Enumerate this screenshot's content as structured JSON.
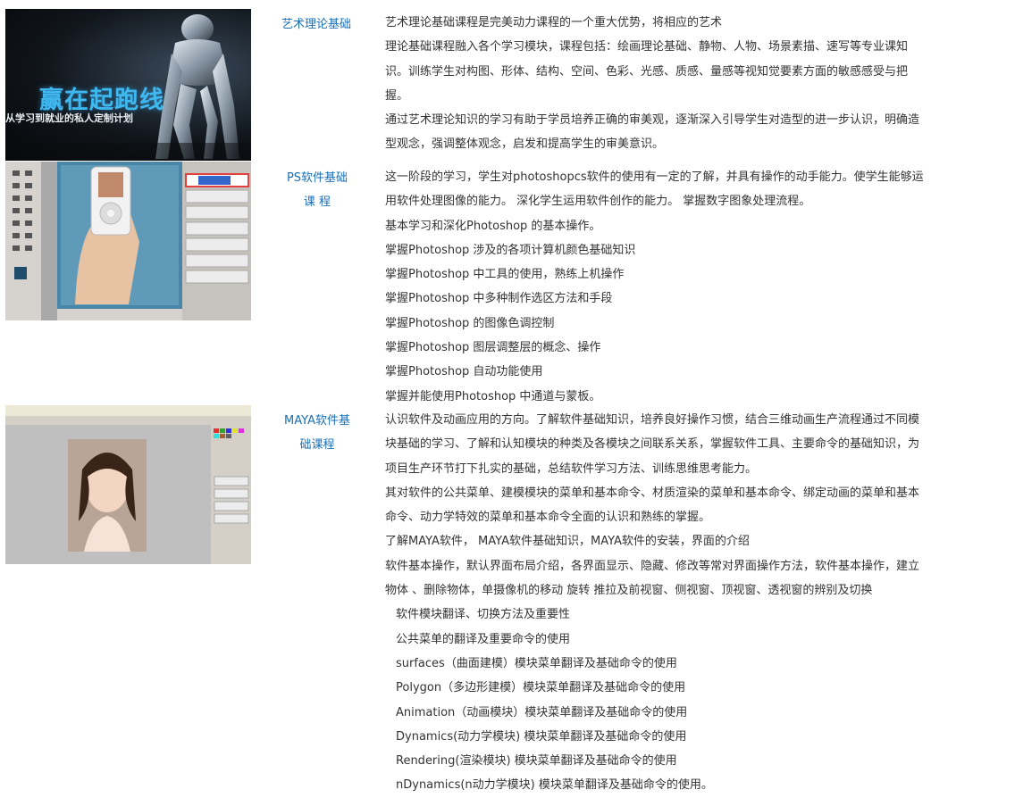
{
  "images": [
    {
      "name": "banner",
      "text_big": "赢在起跑线",
      "text_small": "从学习到就业的私人定制计划"
    },
    {
      "name": "photoshop-screenshot"
    },
    {
      "name": "maya-screenshot"
    }
  ],
  "sections": [
    {
      "label": "艺术理论基础",
      "lines": [
        "艺术理论基础课程是完美动力课程的一个重大优势，将相应的艺术",
        "理论基础课程融入各个学习模块，课程包括：绘画理论基础、静物、人物、场景素描、速写等专业课知识。训练学生对构图、形体、结构、空间、色彩、光感、质感、量感等视知觉要素方面的敏感感受与把握。",
        "通过艺术理论知识的学习有助于学员培养正确的审美观，逐渐深入引导学生对造型的进一步认识，明确造型观念，强调整体观念，启发和提高学生的审美意识。"
      ]
    },
    {
      "label1": "PS软件基础",
      "label2": "课 程",
      "lines": [
        "这一阶段的学习，学生对photoshopcs软件的使用有一定的了解，并具有操作的动手能力。使学生能够运用软件处理图像的能力。 深化学生运用软件创作的能力。 掌握数字图象处理流程。",
        "基本学习和深化Photoshop 的基本操作。",
        "掌握Photoshop 涉及的各项计算机颜色基础知识",
        "掌握Photoshop 中工具的使用，熟练上机操作",
        "掌握Photoshop 中多种制作选区方法和手段",
        "掌握Photoshop 的图像色调控制",
        "掌握Photoshop 图层调整层的概念、操作",
        "掌握Photoshop 自动功能使用",
        "掌握并能使用Photoshop 中通道与蒙板。"
      ]
    },
    {
      "label1": "MAYA软件基",
      "label2": "础课程",
      "lines": [
        "认识软件及动画应用的方向。了解软件基础知识，培养良好操作习惯，结合三维动画生产流程通过不同模块基础的学习、了解和认知模块的种类及各模块之间联系关系，掌握软件工具、主要命令的基础知识，为项目生产环节打下扎实的基础，总结软件学习方法、训练思维思考能力。",
        "其对软件的公共菜单、建模模块的菜单和基本命令、材质渲染的菜单和基本命令、绑定动画的菜单和基本命令、动力学特效的菜单和基本命令全面的认识和熟练的掌握。",
        "了解MAYA软件， MAYA软件基础知识，MAYA软件的安装，界面的介绍",
        "软件基本操作，默认界面布局介绍，各界面显示、隐藏、修改等常对界面操作方法，软件基本操作，建立物体 、删除物体，单摄像机的移动  旋转  推拉及前视窗、侧视窗、顶视窗、透视窗的辨别及切换"
      ],
      "indented": [
        "软件模块翻译、切换方法及重要性",
        "公共菜单的翻译及重要命令的使用",
        "surfaces（曲面建模）模块菜单翻译及基础命令的使用",
        "Polygon（多边形建模）模块菜单翻译及基础命令的使用",
        "Animation（动画模块）模块菜单翻译及基础命令的使用",
        "Dynamics(动力学模块) 模块菜单翻译及基础命令的使用",
        "Rendering(渲染模块) 模块菜单翻译及基础命令的使用",
        "nDynamics(n动力学模块) 模块菜单翻译及基础命令的使用。"
      ]
    }
  ]
}
